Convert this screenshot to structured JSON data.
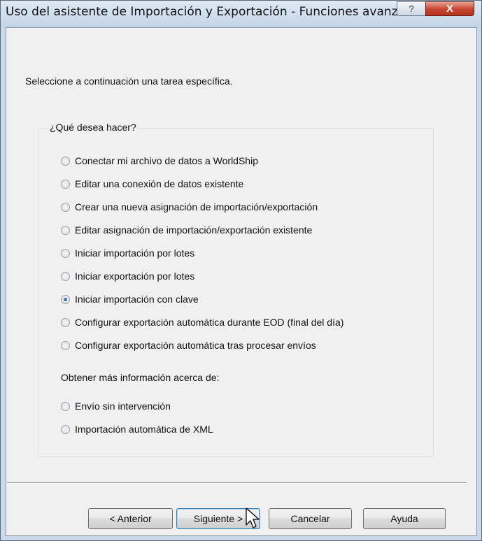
{
  "window": {
    "title": "Uso del asistente de Importación y Exportación - Funciones avanzadas",
    "help_glyph": "?",
    "close_glyph": "X"
  },
  "prompt": "Seleccione a continuación una tarea específica.",
  "group": {
    "legend": "¿Qué desea hacer?",
    "options": [
      {
        "label": "Conectar mi archivo de datos a WorldShip",
        "checked": false
      },
      {
        "label": "Editar una conexión de datos existente",
        "checked": false
      },
      {
        "label": "Crear una nueva asignación de importación/exportación",
        "checked": false
      },
      {
        "label": "Editar asignación de importación/exportación existente",
        "checked": false
      },
      {
        "label": "Iniciar importación por lotes",
        "checked": false
      },
      {
        "label": "Iniciar exportación por lotes",
        "checked": false
      },
      {
        "label": "Iniciar importación con clave",
        "checked": true
      },
      {
        "label": "Configurar exportación automática durante EOD (final del día)",
        "checked": false
      },
      {
        "label": "Configurar exportación automática tras procesar envíos",
        "checked": false
      }
    ],
    "subheading": "Obtener más información acerca de:",
    "info_options": [
      {
        "label": "Envío sin intervención",
        "checked": false
      },
      {
        "label": "Importación automática de XML",
        "checked": false
      }
    ]
  },
  "buttons": {
    "back": "< Anterior",
    "next": "Siguiente >",
    "cancel": "Cancelar",
    "help": "Ayuda"
  }
}
